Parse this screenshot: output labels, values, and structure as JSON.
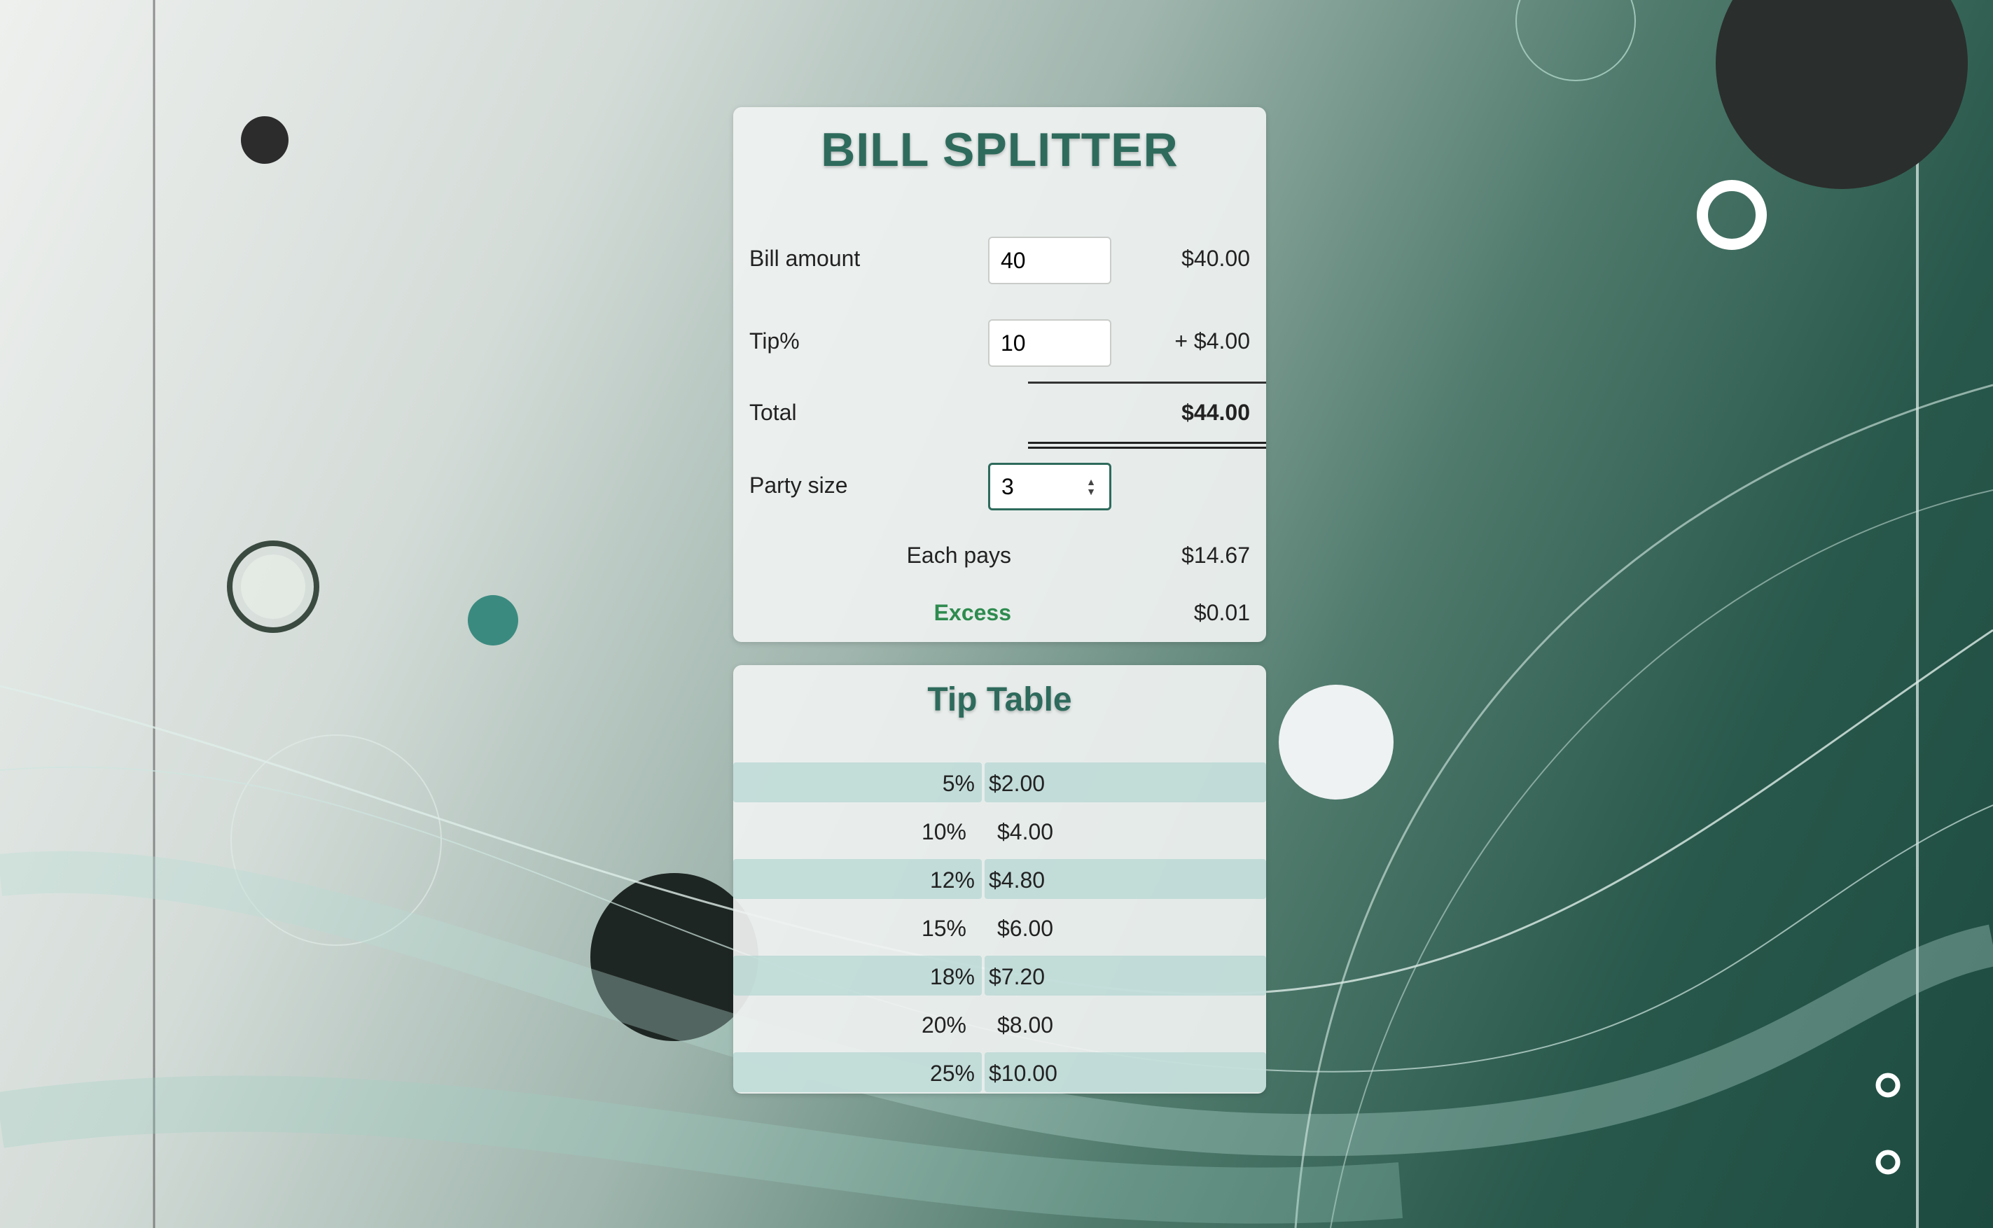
{
  "app": {
    "title": "BILL SPLITTER"
  },
  "form": {
    "bill_amount": {
      "label": "Bill amount",
      "value": "40",
      "display": "$40.00"
    },
    "tip_percent": {
      "label": "Tip%",
      "value": "10",
      "display": "+ $4.00"
    },
    "total": {
      "label": "Total",
      "display": "$44.00"
    },
    "party_size": {
      "label": "Party size",
      "value": "3"
    },
    "each_pays": {
      "label": "Each pays",
      "display": "$14.67"
    },
    "excess": {
      "label": "Excess",
      "display": "$0.01"
    }
  },
  "tip_table": {
    "title": "Tip Table",
    "rows": [
      {
        "pct": "5%",
        "amount": "$2.00"
      },
      {
        "pct": "10%",
        "amount": "$4.00"
      },
      {
        "pct": "12%",
        "amount": "$4.80"
      },
      {
        "pct": "15%",
        "amount": "$6.00"
      },
      {
        "pct": "18%",
        "amount": "$7.20"
      },
      {
        "pct": "20%",
        "amount": "$8.00"
      },
      {
        "pct": "25%",
        "amount": "$10.00"
      }
    ]
  },
  "colors": {
    "accent": "#2e6b5c",
    "excess": "#2e8b4f",
    "row_shade": "#aad2cd"
  }
}
